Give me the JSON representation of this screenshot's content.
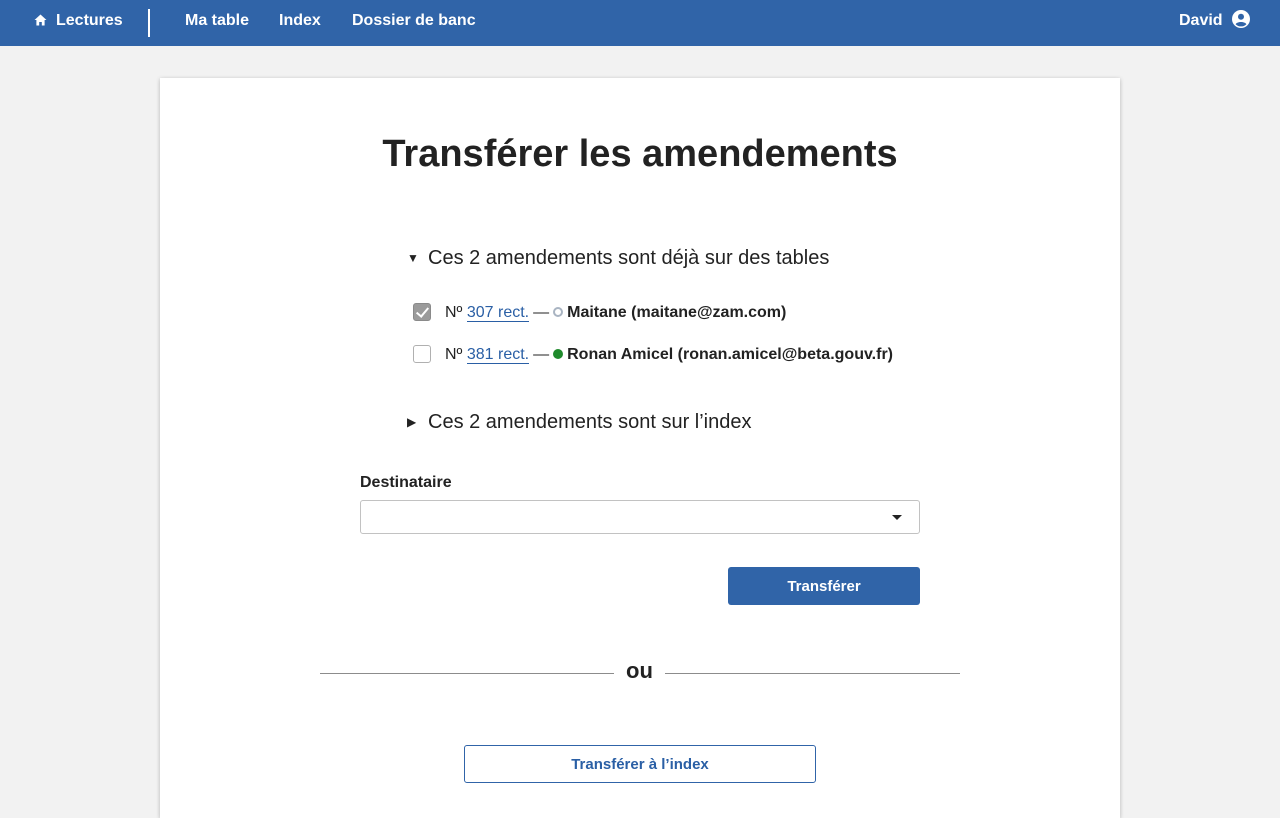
{
  "nav": {
    "home_label": "Lectures",
    "items": [
      "Ma table",
      "Index",
      "Dossier de banc"
    ],
    "user": "David"
  },
  "page": {
    "title": "Transférer les amendements",
    "tables_section": "Ces 2 amendements sont déjà sur des tables",
    "index_section": "Ces 2 amendements sont sur l’index",
    "amendements": [
      {
        "checked": true,
        "prefix": "Nº",
        "number": "307 rect.",
        "separator": "—",
        "status": "offline",
        "user": "Maitane (maitane@zam.com)"
      },
      {
        "checked": false,
        "prefix": "Nº",
        "number": "381 rect.",
        "separator": "—",
        "status": "online",
        "user": "Ronan Amicel (ronan.amicel@beta.gouv.fr)"
      }
    ],
    "destinataire_label": "Destinataire",
    "destinataire_value": "",
    "transfer_button": "Transférer",
    "or_text": "ou",
    "transfer_index_button": "Transférer à l’index"
  },
  "colors": {
    "brand": "#3064a8",
    "link": "#2a5fa5",
    "online": "#1f8a2c",
    "offline": "#a9b4c2"
  }
}
